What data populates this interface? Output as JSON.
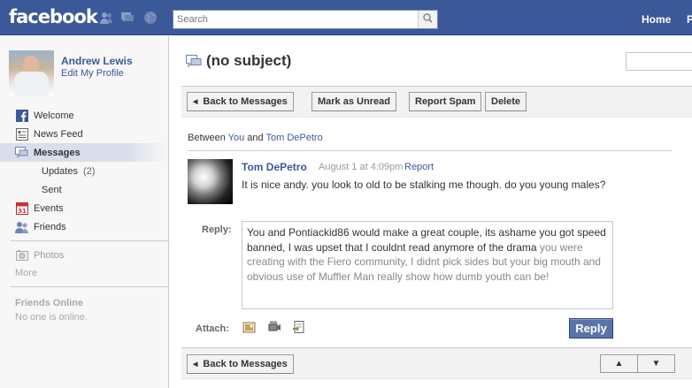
{
  "header": {
    "logo": "facebook",
    "search_placeholder": "Search",
    "home_label": "Home",
    "profile_label": "P"
  },
  "user": {
    "name": "Andrew Lewis",
    "edit_profile": "Edit My Profile"
  },
  "sidebar": {
    "items": [
      {
        "label": "Welcome",
        "icon": "facebook-icon"
      },
      {
        "label": "News Feed",
        "icon": "news-feed-icon"
      },
      {
        "label": "Messages",
        "icon": "messages-icon",
        "selected": true
      },
      {
        "label": "Events",
        "icon": "calendar-icon"
      },
      {
        "label": "Friends",
        "icon": "friends-icon"
      }
    ],
    "sub_items": [
      {
        "label": "Updates",
        "count": "(2)"
      },
      {
        "label": "Sent"
      }
    ],
    "photos_label": "Photos",
    "more_label": "More",
    "friends_online_title": "Friends Online",
    "friends_online_text": "No one is online."
  },
  "thread": {
    "subject": "(no subject)",
    "back_label": "Back to Messages",
    "mark_unread_label": "Mark as Unread",
    "report_spam_label": "Report Spam",
    "delete_label": "Delete",
    "between_prefix": "Between",
    "participant_1": "You",
    "and_word": "and",
    "participant_2": "Tom DePetro"
  },
  "message": {
    "sender": "Tom DePetro",
    "date": "August 1 at 4:09pm",
    "report_label": "Report",
    "body": "It is nice andy. you look to old to be stalking me though. do you young males?"
  },
  "reply": {
    "label": "Reply:",
    "text_main": "You and Pontiackid86 would make a great couple, its ashame you got speed banned, I was upset that I couldnt read anymore of the drama",
    "text_faded": "you were creating with the Fiero community, I didnt pick sides but your big mouth and obvious use of Muffler Man really show how dumb youth can be!",
    "attach_label": "Attach:",
    "attach_icons": [
      "photo-icon",
      "video-icon",
      "link-icon"
    ],
    "button_label": "Reply"
  },
  "bottom": {
    "back_label": "Back to Messages",
    "up_symbol": "▲",
    "down_symbol": "▼"
  }
}
